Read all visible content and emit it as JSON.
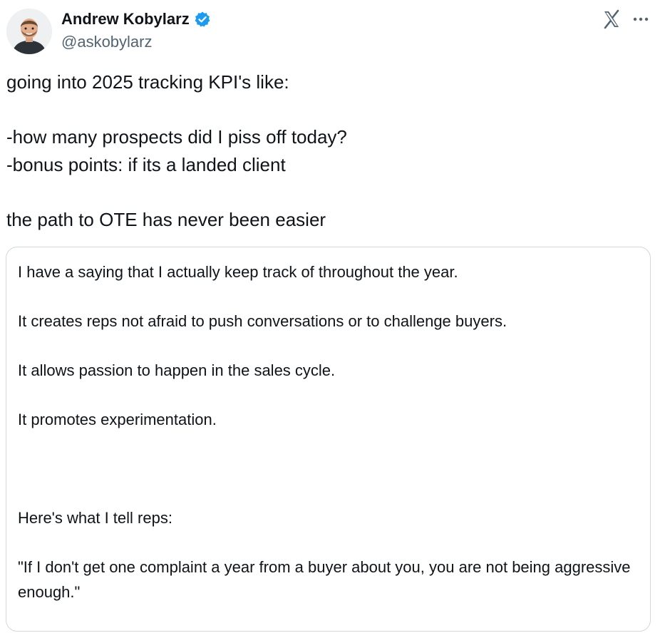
{
  "author": {
    "name": "Andrew Kobylarz",
    "handle": "@askobylarz",
    "verified": true,
    "verified_icon": "verified-badge-icon",
    "verified_color": "#1d9bf0"
  },
  "header_icons": {
    "platform_logo": "x-logo-icon",
    "more": "more-options-icon"
  },
  "tweet": {
    "text": "going into 2025 tracking KPI's like:\n\n-how many prospects did I piss off today?\n-bonus points: if its a landed client\n\nthe path to OTE has never been easier"
  },
  "quote": {
    "text": "I have a saying that I actually keep track of throughout the year.\n\nIt creates reps not afraid to push conversations or to challenge buyers.\n\nIt allows passion to happen in the sales cycle.\n\nIt promotes experimentation.\n\n\n\nHere's what I tell reps:\n\n\"If I don't get one complaint a year from a buyer about you, you are not being aggressive enough.\""
  },
  "colors": {
    "text": "#0f1419",
    "secondary_text": "#536471",
    "border": "#cfd9de"
  }
}
